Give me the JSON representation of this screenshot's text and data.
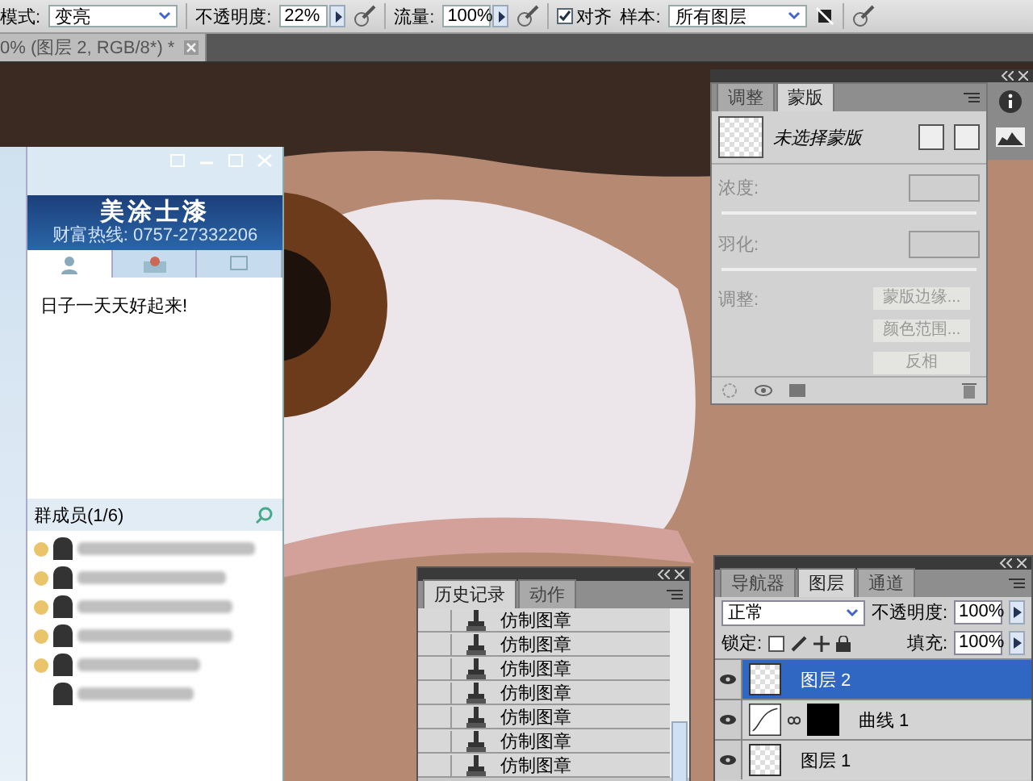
{
  "options_bar": {
    "mode_label": "模式:",
    "mode": "变亮",
    "opacity_label": "不透明度:",
    "opacity": "22%",
    "flow_label": "流量:",
    "flow": "100%",
    "align": {
      "label": "对齐",
      "checked": true
    },
    "sample_label": "样本:",
    "sample": "所有图层"
  },
  "document_tab": {
    "title": "0% (图层 2, RGB/8*) *"
  },
  "chat_window": {
    "banner_title": "美涂士漆",
    "hotline": "财富热线: 0757-27332206",
    "tabs": [
      {
        "selected": true
      },
      {
        "selected": false
      },
      {
        "selected": false
      }
    ],
    "announcement": "日子一天天好起来!",
    "members_header": "群成员(1/6)"
  },
  "mask_panel": {
    "tabs": [
      {
        "label": "调整",
        "selected": false
      },
      {
        "label": "蒙版",
        "selected": true
      }
    ],
    "mask_name": "未选择蒙版",
    "density_label": "浓度:",
    "feather_label": "羽化:",
    "refine_label": "调整:",
    "buttons": [
      {
        "label": "蒙版边缘...",
        "disabled": true
      },
      {
        "label": "颜色范围...",
        "disabled": true
      },
      {
        "label": "反相",
        "disabled": true
      }
    ]
  },
  "history_panel": {
    "tabs": [
      {
        "label": "历史记录",
        "selected": true
      },
      {
        "label": "动作",
        "selected": false
      }
    ],
    "states": [
      {
        "label": "仿制图章"
      },
      {
        "label": "仿制图章"
      },
      {
        "label": "仿制图章"
      },
      {
        "label": "仿制图章"
      },
      {
        "label": "仿制图章"
      },
      {
        "label": "仿制图章"
      },
      {
        "label": "仿制图章"
      }
    ]
  },
  "layers_panel": {
    "tabs": [
      {
        "label": "导航器",
        "selected": false
      },
      {
        "label": "图层",
        "selected": true
      },
      {
        "label": "通道",
        "selected": false
      }
    ],
    "blend_mode": "正常",
    "opacity_label": "不透明度:",
    "opacity": "100%",
    "lock_label": "锁定:",
    "fill_label": "填充:",
    "fill": "100%",
    "layers": [
      {
        "name": "图层 2",
        "kind": "pixel",
        "visible": true,
        "selected": true
      },
      {
        "name": "曲线 1",
        "kind": "adjustment",
        "visible": true,
        "selected": false
      },
      {
        "name": "图层 1",
        "kind": "pixel",
        "visible": true,
        "selected": false
      }
    ]
  }
}
